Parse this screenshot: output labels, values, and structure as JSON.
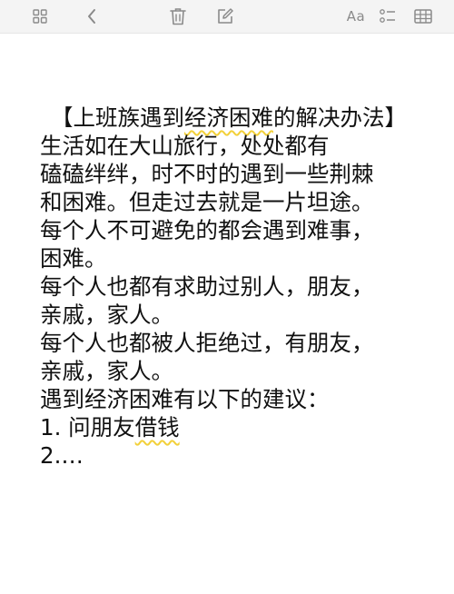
{
  "toolbar": {
    "left_icons": [
      "grid-icon",
      "chevron-left-icon"
    ],
    "center_icons": [
      "trash-icon",
      "compose-icon"
    ],
    "format_label": "Aa",
    "right_icons": [
      "checklist-icon",
      "table-icon"
    ],
    "icon_color": "#8a8a8a"
  },
  "note": {
    "title": {
      "before": "【上班族遇到",
      "highlight": "经济困难",
      "after": "的解决办法】"
    },
    "lines": [
      "生活如在大山旅行，处处都有",
      "磕磕绊绊，时不时的遇到一些荆棘",
      "和困难。但走过去就是一片坦途。",
      "每个人不可避免的都会遇到难事，",
      "困难。",
      "每个人也都有求助过别人，朋友，",
      "亲戚，家人。",
      "每个人也都被人拒绝过，有朋友，",
      "亲戚，家人。",
      "遇到经济困难有以下的建议："
    ],
    "item1": {
      "before": "1. 问朋友",
      "highlight": "借钱"
    },
    "item2": "2.…",
    "highlight_color": "#f2d03a"
  }
}
